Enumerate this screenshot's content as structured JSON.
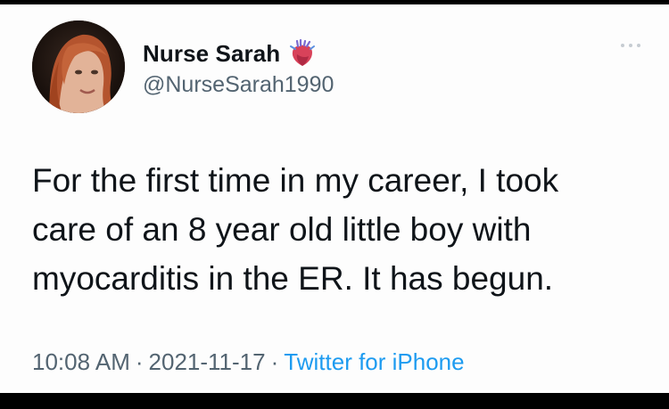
{
  "tweet": {
    "author": {
      "display_name": "Nurse Sarah",
      "handle": "@NurseSarah1990",
      "badge_icon": "anatomical-heart-icon",
      "avatar_icon": "profile-photo"
    },
    "text": "For the first time in my career, I took\ncare of an 8 year old little boy with\nmyocarditis in the ER.  It has begun.",
    "time": "10:08 AM",
    "date": "2021-11-17",
    "separator": "·",
    "source": "Twitter for iPhone",
    "menu_icon": "more-dots-icon"
  },
  "colors": {
    "text": "#0f1419",
    "secondary": "#536471",
    "link": "#1d9bf0",
    "background": "#fdfdfd",
    "border": "#000000"
  }
}
